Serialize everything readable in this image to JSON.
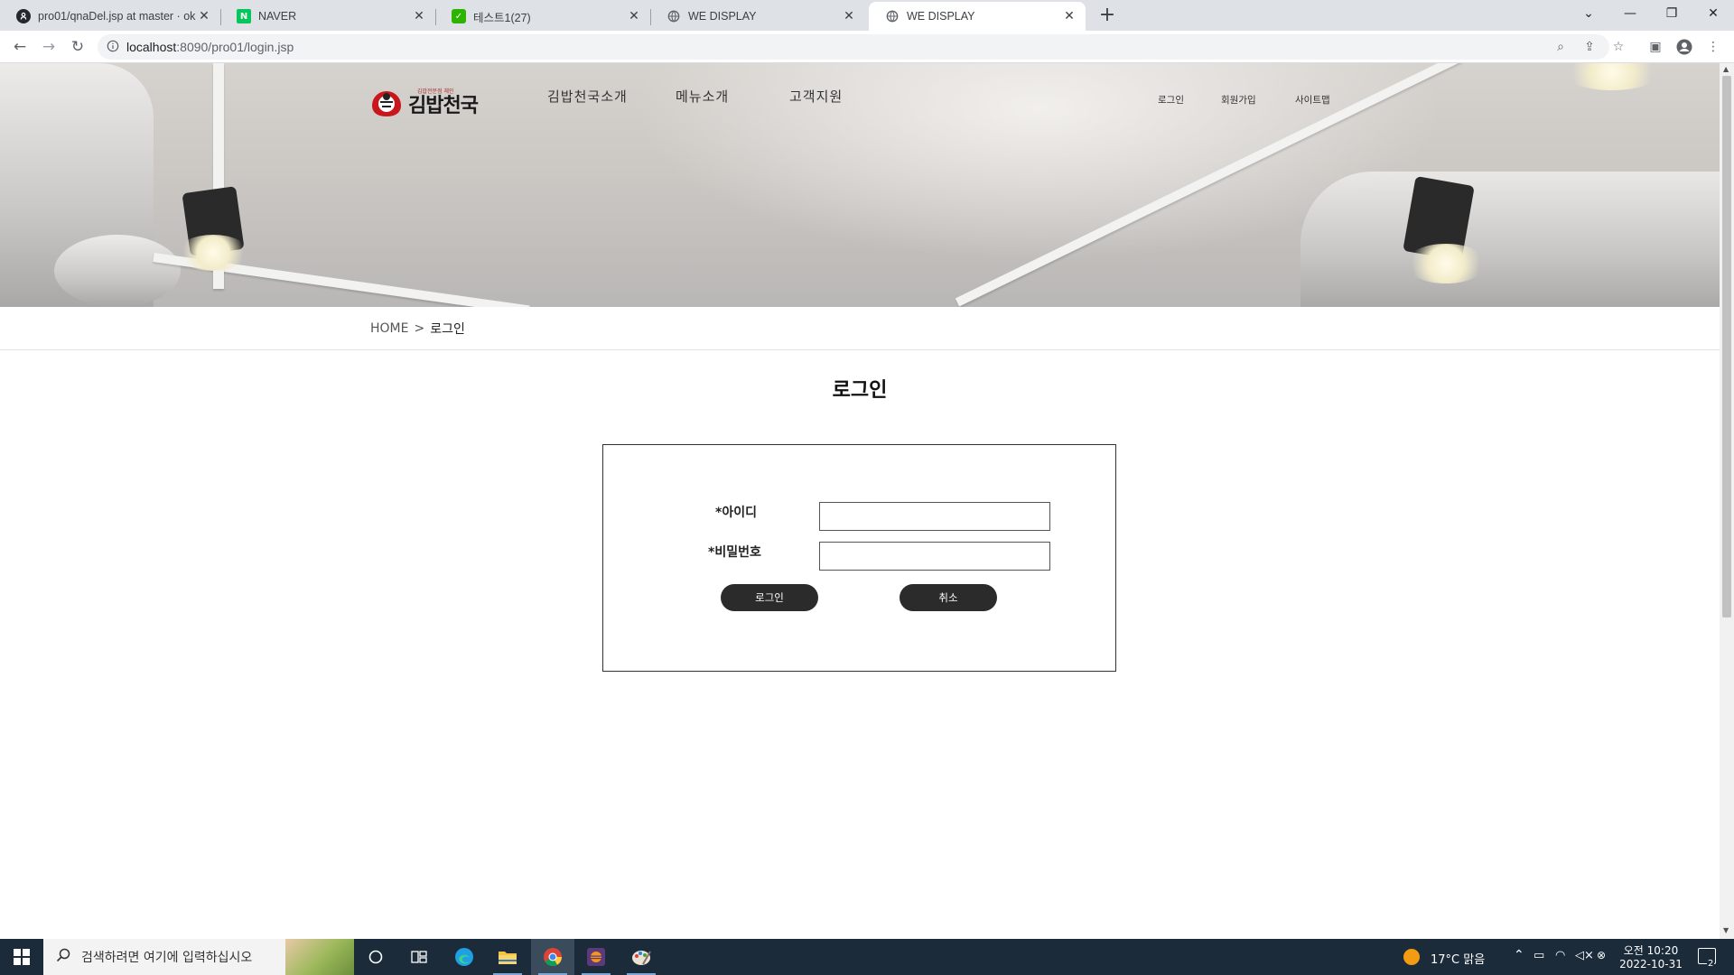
{
  "browser": {
    "tabs": [
      {
        "title": "pro01/qnaDel.jsp at master · ok",
        "icon": "github-icon",
        "active": false
      },
      {
        "title": "NAVER",
        "icon": "naver-icon",
        "active": false
      },
      {
        "title": "테스트1(27)",
        "icon": "chat-icon",
        "active": false
      },
      {
        "title": "WE DISPLAY",
        "icon": "globe-icon",
        "active": false
      },
      {
        "title": "WE DISPLAY",
        "icon": "globe-icon",
        "active": true
      }
    ],
    "url_host": "localhost",
    "url_path": ":8090/pro01/login.jsp"
  },
  "site": {
    "logo_text": "김밥천국",
    "logo_tagline": "김밥전문점 체인",
    "main_nav": [
      "김밥천국소개",
      "메뉴소개",
      "고객지원"
    ],
    "util_nav": [
      "로그인",
      "회원가입",
      "사이트맵"
    ],
    "breadcrumb": {
      "home": "HOME",
      "separator": ">",
      "current": "로그인"
    },
    "page_title": "로그인"
  },
  "login_form": {
    "id_label": "*아이디",
    "id_value": "",
    "pw_label": "*비밀번호",
    "pw_value": "",
    "login_button": "로그인",
    "cancel_button": "취소"
  },
  "taskbar": {
    "search_placeholder": "검색하려면 여기에 입력하십시오",
    "weather": "17°C 맑음",
    "time_period": "오전 10:20",
    "date": "2022-10-31",
    "notification_count": "2"
  },
  "colors": {
    "button_bg": "#2b2b2b",
    "taskbar_bg": "#1c2b3a",
    "tabstrip_bg": "#dee1e6"
  }
}
